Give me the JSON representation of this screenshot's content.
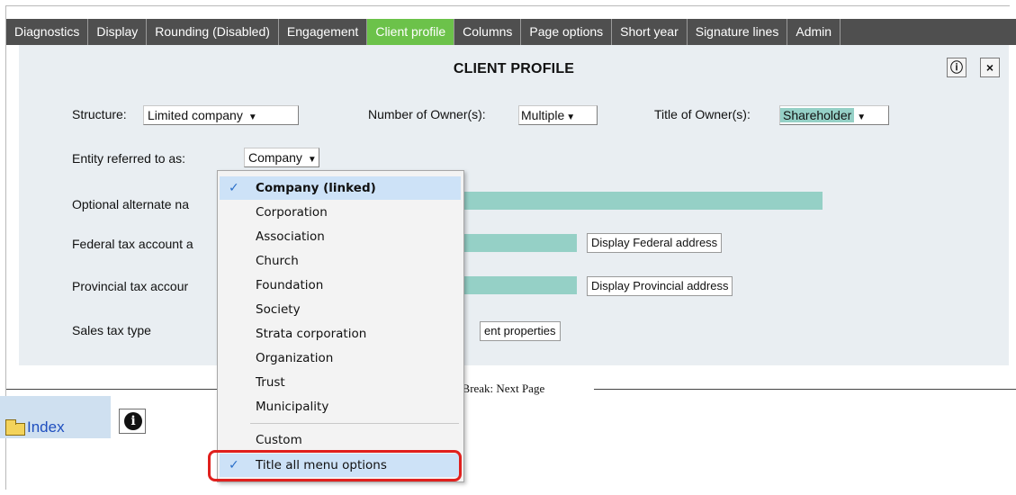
{
  "tabs": [
    {
      "label": "Diagnostics",
      "active": false
    },
    {
      "label": "Display",
      "active": false
    },
    {
      "label": "Rounding (Disabled)",
      "active": false
    },
    {
      "label": "Engagement",
      "active": false
    },
    {
      "label": "Client profile",
      "active": true
    },
    {
      "label": "Columns",
      "active": false
    },
    {
      "label": "Page options",
      "active": false
    },
    {
      "label": "Short year",
      "active": false
    },
    {
      "label": "Signature lines",
      "active": false
    },
    {
      "label": "Admin",
      "active": false
    }
  ],
  "panel": {
    "title": "CLIENT PROFILE",
    "info_button": "ⓘ",
    "close_button": "×"
  },
  "form": {
    "structure_label": "Structure:",
    "structure_value": "Limited company",
    "owners_label": "Number of Owner(s):",
    "owners_value": "Multiple",
    "title_owner_label": "Title of Owner(s):",
    "title_owner_value": "Shareholder",
    "entity_label": "Entity referred to as:",
    "entity_value": "Company",
    "alt_name_label": "Optional alternate na",
    "federal_label": "Federal tax account a",
    "federal_button": "Display Federal address",
    "provincial_label": "Provincial tax accour",
    "provincial_button": "Display Provincial address",
    "sales_tax_label": "Sales tax type",
    "sales_tax_button": "ent properties"
  },
  "page_break_text": "ge Break: Next Page",
  "bottom": {
    "index_label": "Index",
    "info_icon": "i"
  },
  "menu": {
    "items": [
      {
        "label": "Company (linked)",
        "checked": true,
        "bold": true
      },
      {
        "label": "Corporation"
      },
      {
        "label": "Association"
      },
      {
        "label": "Church"
      },
      {
        "label": "Foundation"
      },
      {
        "label": "Society"
      },
      {
        "label": "Strata corporation"
      },
      {
        "label": "Organization"
      },
      {
        "label": "Trust"
      },
      {
        "label": "Municipality"
      }
    ],
    "custom_label": "Custom",
    "title_all_label": "Title all menu options",
    "check_glyph": "✓"
  },
  "colors": {
    "tab_bar": "#4f4f4f",
    "tab_active": "#6cc24a",
    "panel_bg": "#e9eef2",
    "field_teal": "#95d0c6",
    "highlight_red": "#e0201d"
  }
}
